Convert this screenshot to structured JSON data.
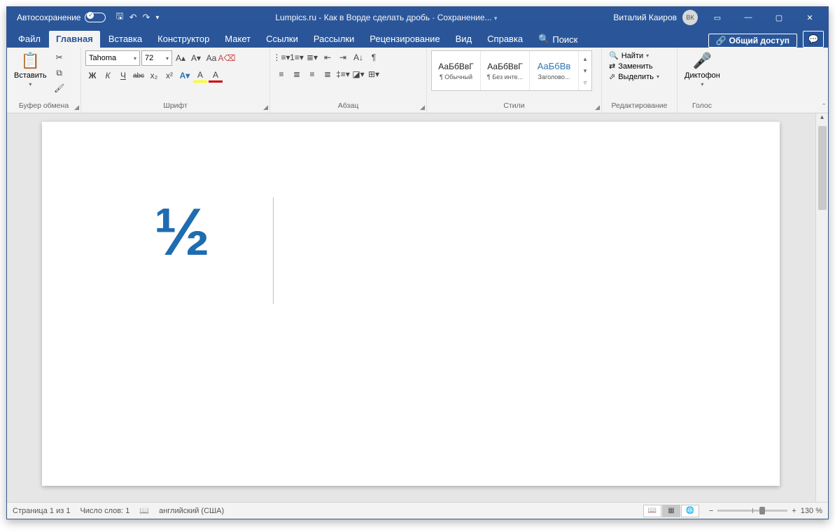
{
  "titlebar": {
    "autosave": "Автосохранение",
    "title": "Lumpics.ru - Как в Ворде сделать дробь",
    "saving": "Сохранение...",
    "user": "Виталий Каиров",
    "initials": "ВК"
  },
  "tabs": {
    "file": "Файл",
    "home": "Главная",
    "insert": "Вставка",
    "design": "Конструктор",
    "layout": "Макет",
    "references": "Ссылки",
    "mailings": "Рассылки",
    "review": "Рецензирование",
    "view": "Вид",
    "help": "Справка",
    "search": "Поиск",
    "share": "Общий доступ"
  },
  "ribbon": {
    "clipboard": {
      "label": "Буфер обмена",
      "paste": "Вставить"
    },
    "font": {
      "label": "Шрифт",
      "name": "Tahoma",
      "size": "72",
      "bold": "Ж",
      "italic": "К",
      "underline": "Ч",
      "strike": "abc",
      "sub": "x₂",
      "sup": "x²",
      "caseAa": "Aa",
      "clear": "A"
    },
    "paragraph": {
      "label": "Абзац"
    },
    "styles": {
      "label": "Стили",
      "items": [
        {
          "preview": "АаБбВвГ",
          "name": "¶ Обычный"
        },
        {
          "preview": "АаБбВвГ",
          "name": "¶ Без инте..."
        },
        {
          "preview": "АаБбВв",
          "name": "Заголово..."
        }
      ]
    },
    "editing": {
      "label": "Редактирование",
      "find": "Найти",
      "replace": "Заменить",
      "select": "Выделить"
    },
    "voice": {
      "label": "Голос",
      "dictate": "Диктофон"
    }
  },
  "document": {
    "content": "½"
  },
  "status": {
    "page": "Страница 1 из 1",
    "words": "Число слов: 1",
    "lang": "английский (США)",
    "zoom": "130 %"
  }
}
